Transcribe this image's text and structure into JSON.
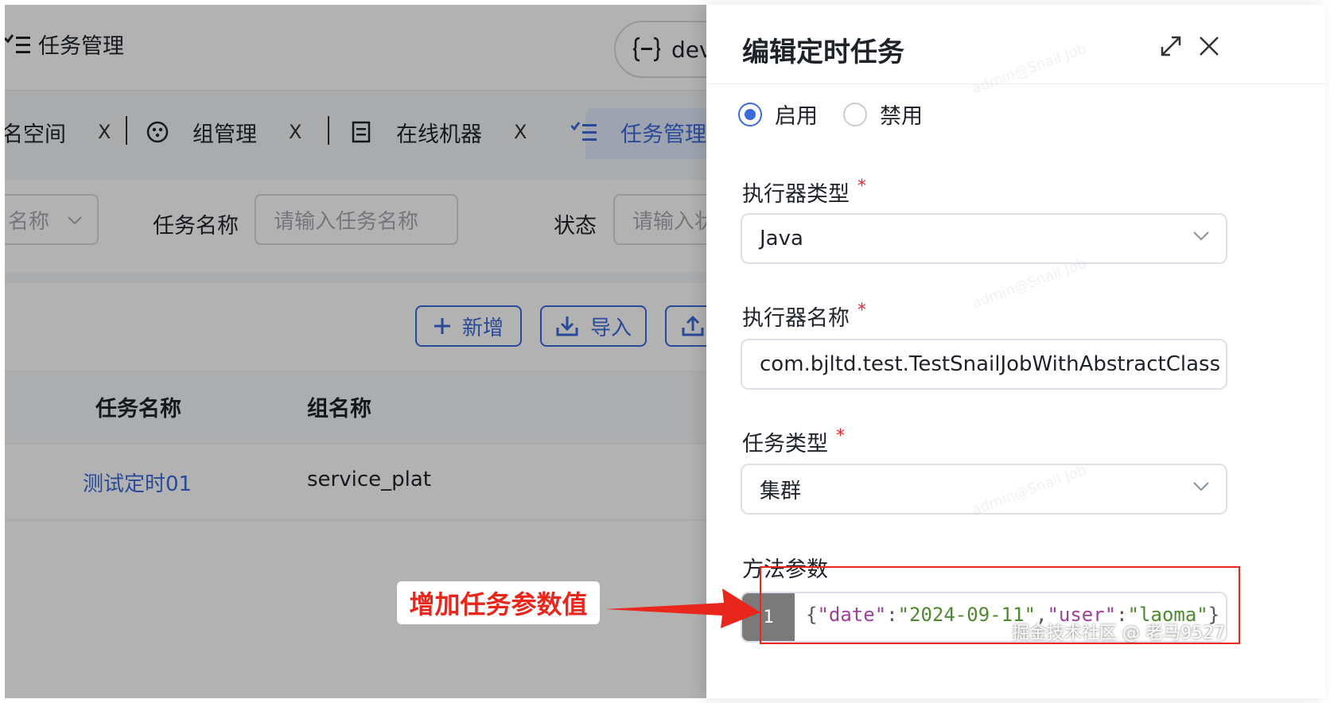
{
  "header": {
    "page_title": "任务管理",
    "env": "dev"
  },
  "tabs": [
    {
      "label": "名空间",
      "icon": "namespace-icon"
    },
    {
      "label": "组管理",
      "icon": "group-icon"
    },
    {
      "label": "在线机器",
      "icon": "machine-list-icon"
    },
    {
      "label": "任务管理",
      "icon": "task-list-icon"
    }
  ],
  "tab_close": "X",
  "filters": {
    "group_select_text": "名称",
    "task_name_label": "任务名称",
    "task_name_placeholder": "请输入任务名称",
    "status_label": "状态",
    "status_placeholder": "请输入状"
  },
  "toolbar": {
    "add_label": "新增",
    "import_label": "导入"
  },
  "table": {
    "columns": [
      "任务名称",
      "组名称"
    ],
    "rows": [
      {
        "task_name": "测试定时01",
        "group_name": "service_plat"
      }
    ]
  },
  "drawer": {
    "title": "编辑定时任务",
    "status_options": {
      "enabled": "启用",
      "disabled": "禁用",
      "selected": "启用"
    },
    "executor_type_label": "执行器类型",
    "executor_type_value": "Java",
    "executor_name_label": "执行器名称",
    "executor_name_value": "com.bjltd.test.TestSnailJobWithAbstractClass",
    "task_type_label": "任务类型",
    "task_type_value": "集群",
    "method_params_label": "方法参数",
    "required_mark": "*",
    "code": {
      "line_number": "1",
      "tokens": [
        {
          "t": "{",
          "c": "punc"
        },
        {
          "t": "\"date\"",
          "c": "key"
        },
        {
          "t": ":",
          "c": "punc"
        },
        {
          "t": "\"2024-09-11\"",
          "c": "str"
        },
        {
          "t": ",",
          "c": "punc"
        },
        {
          "t": "\"user\"",
          "c": "key"
        },
        {
          "t": ":",
          "c": "punc"
        },
        {
          "t": "\"laoma\"",
          "c": "str"
        },
        {
          "t": "}",
          "c": "punc"
        }
      ]
    }
  },
  "watermark_text": "admin@Snail Job",
  "annotation": {
    "callout_text": "增加任务参数值",
    "color": "#e8261b"
  },
  "footer_watermark": "掘金技术社区 @ 老马9527",
  "colors": {
    "primary": "#3c6bdb",
    "link": "#3c6bdb",
    "required": "#f5222d"
  }
}
